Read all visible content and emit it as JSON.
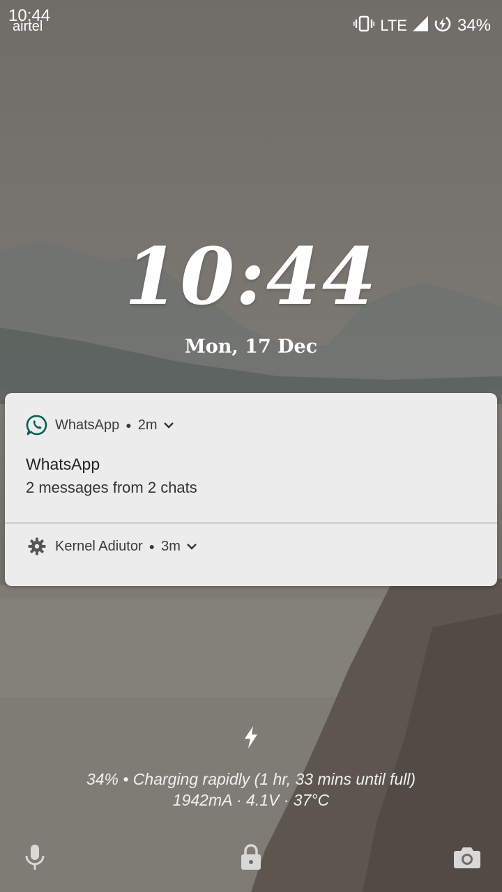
{
  "status_bar": {
    "time": "10:44",
    "carrier": "airtel",
    "network": "LTE",
    "battery_percent": "34%",
    "icons": [
      "vibrate-icon",
      "signal-icon",
      "battery-charging-icon"
    ]
  },
  "lockscreen": {
    "clock": "10:44",
    "date": "Mon, 17 Dec"
  },
  "notifications": [
    {
      "app": "WhatsApp",
      "time": "2m",
      "icon": "whatsapp-icon",
      "title": "WhatsApp",
      "body": "2 messages from 2 chats"
    },
    {
      "app": "Kernel Adiutor",
      "time": "3m",
      "icon": "gear-icon"
    }
  ],
  "charging": {
    "line1": "34% • Charging rapidly (1 hr, 33 mins until full)",
    "line2": "1942mA · 4.1V · 37°C"
  },
  "bottom_actions": [
    "mic-icon",
    "lock-icon",
    "camera-icon"
  ],
  "colors": {
    "whatsapp_green": "#075E54",
    "card_background": "#ececec"
  }
}
